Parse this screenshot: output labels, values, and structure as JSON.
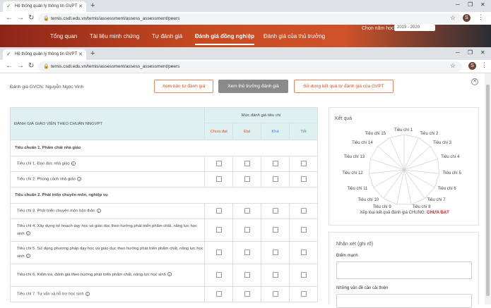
{
  "browser_back": {
    "tab_title": "Hệ thống quản lý thông tin GVPT",
    "url": "temis.csdl.edu.vn/temis/assessment/assess_assessment/peers"
  },
  "browser_front": {
    "tab_title": "Hệ thống quản lý thông tin GVPT",
    "url": "temis.csdl.edu.vn/temis/assessment/assess_assessment/peers",
    "profile_initial": "S"
  },
  "navbar": {
    "school_year_label": "Chọn năm học",
    "school_year_value": "2019 - 2020",
    "links": [
      "Tổng quan",
      "Tài liệu minh chứng",
      "Tự đánh giá",
      "Đánh giá đồng nghiệp",
      "Đánh giá của thủ trưởng"
    ]
  },
  "teacher_label": "Đánh giá GVCN: Nguyễn Ngọc Vinh",
  "buttons": {
    "view_self": "Xem bản tự đánh giá",
    "view_principal": "Xem thủ trưởng đánh giá",
    "use_result": "Sử dụng kết quả tự đánh giá của GVPT"
  },
  "table": {
    "title": "ĐÁNH GIÁ GIÁO VIÊN THEO CHUẨN NNGVPT",
    "level_header": "Mức đánh giá tiêu chí",
    "levels": [
      "Chưa đạt",
      "Đạt",
      "Khá",
      "Tốt"
    ],
    "standard1": "Tiêu chuẩn 1. Phẩm chất nhà giáo",
    "c1": "Tiêu chí 1. Đạo đức nhà giáo",
    "c2": "Tiêu chí 2. Phong cách nhà giáo",
    "standard2": "Tiêu chuẩn 2. Phát triển chuyên môn, nghiệp vụ",
    "c3": "Tiêu chí 3. Phát triển chuyên môn bản thân",
    "c4": "Tiêu chí 4. Xây dựng kế hoạch dạy học và giáo dục theo hướng phát triển phẩm chất, năng lực học sinh",
    "c5": "Tiêu chí 5. Sử dụng phương pháp dạy học và giáo dục theo hướng phát triển phẩm chất, năng lực học sinh",
    "c6": "Tiêu chí 6. Kiểm tra, đánh giá theo hướng phát triển phẩm chất, năng lực học sinh",
    "c7": "Tiêu chí 7. Tư vấn và hỗ trợ học sinh"
  },
  "result": {
    "title": "Kết quả",
    "radar_labels": [
      "Tiêu chí 1",
      "Tiêu chí 2",
      "Tiêu chí 3",
      "Tiêu chí 4",
      "Tiêu chí 5",
      "Tiêu chí 6",
      "Tiêu chí 7",
      "Tiêu chí 8",
      "Tiêu chí 9",
      "Tiêu chí 10",
      "Tiêu chí 11",
      "Tiêu chí 12",
      "Tiêu chí 13",
      "Tiêu chí 14",
      "Tiêu chí 15"
    ],
    "overall_label": "Xếp loại kết quả đánh giá CHUNG:",
    "overall_value": "CHƯA ĐẠT",
    "colors": {
      "accent": "#d9541e",
      "fail": "#e0201b"
    }
  },
  "comments": {
    "title": "Nhận xét (ghi rõ)",
    "strengths_label": "Điểm mạnh",
    "improve_label": "Những vấn đề cần cải thiện"
  }
}
